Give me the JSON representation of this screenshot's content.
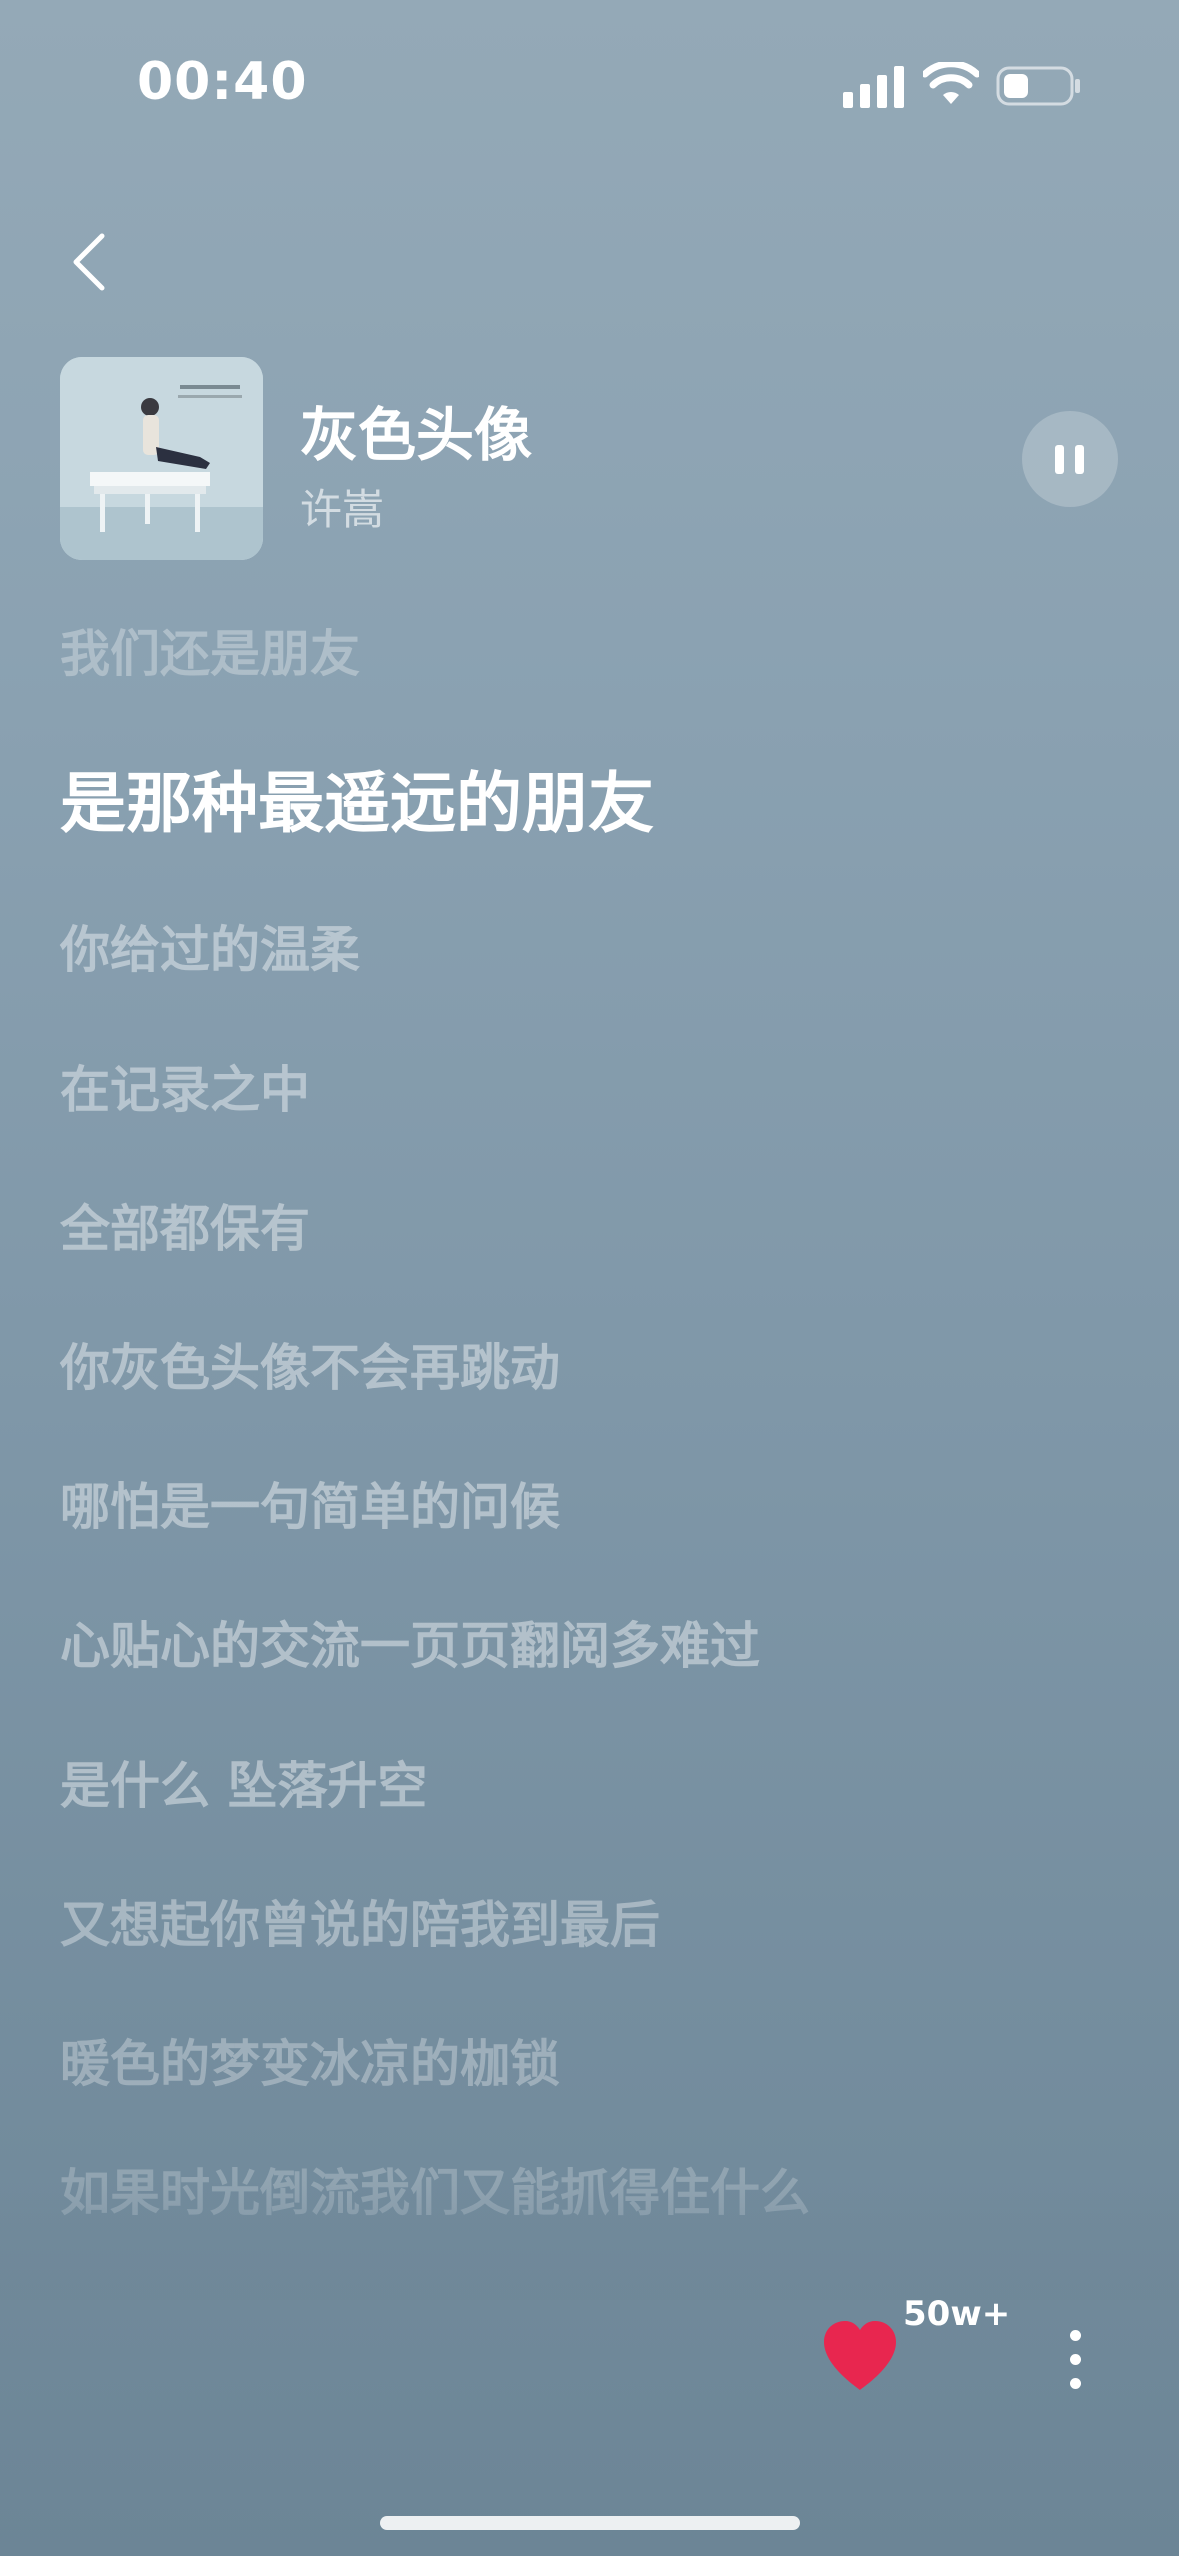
{
  "status_bar": {
    "time": "00:40"
  },
  "now_playing": {
    "title": "灰色头像",
    "artist": "许嵩"
  },
  "lyrics": {
    "lines": [
      "我们还是朋友",
      "是那种最遥远的朋友",
      "你给过的温柔",
      "在记录之中",
      "全部都保有",
      "你灰色头像不会再跳动",
      "哪怕是一句简单的问候",
      "心贴心的交流一页页翻阅多难过",
      "是什么 坠落升空",
      "又想起你曾说的陪我到最后",
      "暖色的梦变冰凉的枷锁",
      "如果时光倒流我们又能抓得住什么"
    ],
    "active_index": 1
  },
  "actions": {
    "like_count": "50w+"
  },
  "colors": {
    "like": "#e8264f",
    "text": "#ffffff"
  },
  "icons": {
    "back": "chevron-left-icon",
    "pause": "pause-icon",
    "like": "heart-icon",
    "more": "more-vertical-icon"
  }
}
